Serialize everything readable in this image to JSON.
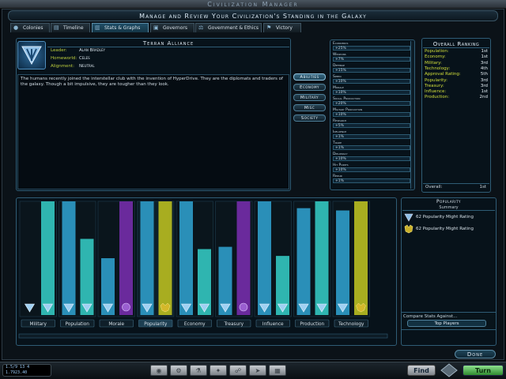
{
  "window": {
    "title": "Civilization Manager",
    "subtitle": "Manage and Review Your Civilization's Standing in the Galaxy"
  },
  "tabs": [
    {
      "label": "Colonies",
      "icon": "planet-icon",
      "active": false
    },
    {
      "label": "Timeline",
      "icon": "timeline-icon",
      "active": false
    },
    {
      "label": "Stats & Graphs",
      "icon": "graph-icon",
      "active": true
    },
    {
      "label": "Governors",
      "icon": "governor-icon",
      "active": false
    },
    {
      "label": "Government & Ethics",
      "icon": "scales-icon",
      "active": false
    },
    {
      "label": "Victory",
      "icon": "flag-icon",
      "active": false
    }
  ],
  "civ": {
    "name": "Terran Alliance",
    "fields": [
      {
        "key": "Leader:",
        "value": "Alan Bradley"
      },
      {
        "key": "Homeworld:",
        "value": "Celes"
      },
      {
        "key": "Alignment:",
        "value": "Neutral"
      }
    ],
    "description": "The humans recently joined the interstellar club with the invention of HyperDrive. They are the diplomats and traders of the galaxy. Though a bit impulsive, they are tougher than they look."
  },
  "categories": [
    {
      "label": "Abilities",
      "active": true
    },
    {
      "label": "Economy",
      "active": false
    },
    {
      "label": "Military",
      "active": false
    },
    {
      "label": "Misc",
      "active": false
    },
    {
      "label": "Society",
      "active": false
    }
  ],
  "bonuses": [
    {
      "name": "Economics",
      "value": "+25%"
    },
    {
      "name": "Weapons",
      "value": "+7%"
    },
    {
      "name": "Defense",
      "value": "+15%"
    },
    {
      "name": "Speed",
      "value": "+10%"
    },
    {
      "name": "Morale",
      "value": "+10%"
    },
    {
      "name": "Social Production",
      "value": "+20%"
    },
    {
      "name": "Military Production",
      "value": "+10%"
    },
    {
      "name": "Research",
      "value": "+5%"
    },
    {
      "name": "Influence",
      "value": "+1%"
    },
    {
      "name": "Trade",
      "value": "+1%"
    },
    {
      "name": "Diplomacy",
      "value": "+10%"
    },
    {
      "name": "Hit Points",
      "value": "+10%"
    },
    {
      "name": "Repair",
      "value": "+1%"
    }
  ],
  "ranking": {
    "title": "Overall Ranking",
    "rows": [
      {
        "label": "Population:",
        "value": "1st"
      },
      {
        "label": "Economy:",
        "value": "1st"
      },
      {
        "label": "Military:",
        "value": "3rd"
      },
      {
        "label": "Technology:",
        "value": "4th"
      },
      {
        "label": "Approval Rating:",
        "value": "5th"
      },
      {
        "label": "Popularity:",
        "value": "3rd"
      },
      {
        "label": "Treasury:",
        "value": "3rd"
      },
      {
        "label": "Influence:",
        "value": "1st"
      },
      {
        "label": "Production:",
        "value": "2nd"
      }
    ],
    "overall_label": "Overall:",
    "overall_value": "1st"
  },
  "colors": {
    "blue": "#2a8fb8",
    "teal": "#2fb5b0",
    "purple": "#6a2a9c",
    "yellow": "#a8ad20"
  },
  "chart_data": {
    "type": "bar",
    "categories": [
      "Military",
      "Population",
      "Morale",
      "Popularity",
      "Economy",
      "Treasury",
      "Influence",
      "Production",
      "Technology"
    ],
    "ylim": [
      0,
      100
    ],
    "groups": [
      {
        "category": "Military",
        "bars": [
          {
            "icon": "terran",
            "color": "blue",
            "value": 0
          },
          {
            "icon": "terran",
            "color": "teal",
            "value": 100
          }
        ]
      },
      {
        "category": "Population",
        "bars": [
          {
            "icon": "terran",
            "color": "blue",
            "value": 100
          },
          {
            "icon": "terran",
            "color": "teal",
            "value": 67
          }
        ]
      },
      {
        "category": "Morale",
        "bars": [
          {
            "icon": "terran",
            "color": "blue",
            "value": 50
          },
          {
            "icon": "alien",
            "color": "purple",
            "value": 100
          }
        ]
      },
      {
        "category": "Popularity",
        "bars": [
          {
            "icon": "terran",
            "color": "blue",
            "value": 100
          },
          {
            "icon": "drengin",
            "color": "yellow",
            "value": 100
          }
        ]
      },
      {
        "category": "Economy",
        "bars": [
          {
            "icon": "terran",
            "color": "blue",
            "value": 100
          },
          {
            "icon": "terran",
            "color": "teal",
            "value": 58
          }
        ]
      },
      {
        "category": "Treasury",
        "bars": [
          {
            "icon": "terran",
            "color": "blue",
            "value": 60
          },
          {
            "icon": "alien",
            "color": "purple",
            "value": 100
          }
        ]
      },
      {
        "category": "Influence",
        "bars": [
          {
            "icon": "terran",
            "color": "blue",
            "value": 100
          },
          {
            "icon": "terran",
            "color": "teal",
            "value": 52
          }
        ]
      },
      {
        "category": "Production",
        "bars": [
          {
            "icon": "terran",
            "color": "blue",
            "value": 94
          },
          {
            "icon": "terran",
            "color": "teal",
            "value": 100
          }
        ]
      },
      {
        "category": "Technology",
        "bars": [
          {
            "icon": "terran",
            "color": "blue",
            "value": 92
          },
          {
            "icon": "drengin",
            "color": "yellow",
            "value": 100
          }
        ]
      }
    ],
    "selected_category": "Popularity"
  },
  "popularity": {
    "title": "Popularity",
    "summary": "Summary",
    "rows": [
      {
        "icon": "terran-emblem-icon",
        "text": "62 Popularity Might Rating"
      },
      {
        "icon": "drengin-emblem-icon",
        "text": "62 Popularity Might Rating"
      }
    ],
    "compare_label": "Compare Stats Against...",
    "compare_value": "Top Players"
  },
  "done_label": "Done",
  "status": {
    "line1": "1.5/9 13 4",
    "line2": "1.7923.40"
  },
  "toolbar_icons": [
    "planet-icon",
    "shipyard-icon",
    "research-icon",
    "galaxy-icon",
    "diplomacy-icon",
    "ships-icon",
    "report-icon"
  ],
  "find_label": "Find",
  "turn_label": "Turn"
}
